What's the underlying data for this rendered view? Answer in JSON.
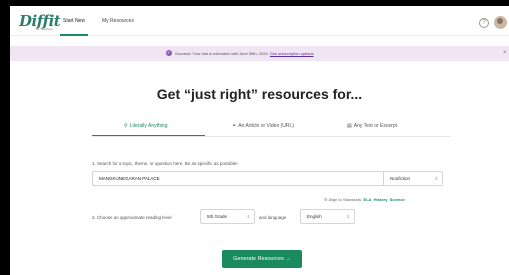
{
  "header": {
    "logo": "Diffit",
    "logo_sub": "for Teachers",
    "tabs": [
      {
        "label": "Start New"
      },
      {
        "label": "My Resources"
      }
    ],
    "help_icon": "?"
  },
  "banner": {
    "message": "Success! Your trial is extended until June 30th, 2024.",
    "link_text": "See subscription options",
    "close": "×"
  },
  "main": {
    "title": "Get “just right” resources for...",
    "mode_tabs": [
      {
        "label": "Literally Anything",
        "icon": "search-icon"
      },
      {
        "label": "An Article or Video (URL)",
        "icon": "link-icon"
      },
      {
        "label": "Any Text or Excerpt",
        "icon": "document-icon"
      }
    ],
    "search_label": "1. Search for a topic, theme, or question here. Be as specific as possible!",
    "search_value": "MANGKUNEGARAN PALACE",
    "type_select": "Nonfiction",
    "standards_label": "Align to Standards",
    "standards": [
      "ELA",
      "History",
      "Science"
    ],
    "reading_label": "2. Choose an approximate reading level",
    "reading_level": "5th Grade",
    "language_label": "and language",
    "language": "English",
    "generate_label": "Generate Resources"
  },
  "colors": {
    "accent": "#1a8a5f",
    "banner_bg": "#efe5f3",
    "banner_icon": "#8e57b5"
  }
}
